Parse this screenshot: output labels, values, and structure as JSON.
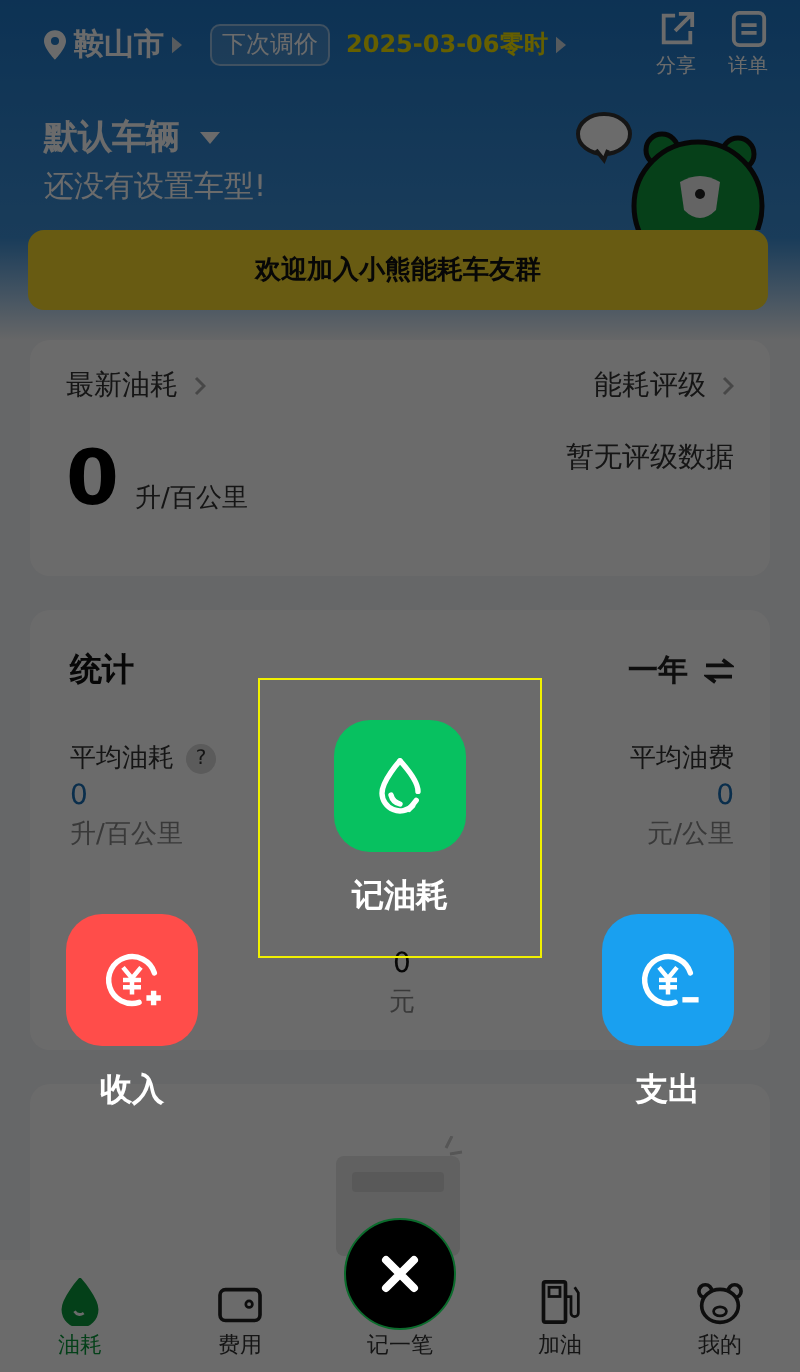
{
  "header": {
    "city": "鞍山市",
    "price_label": "下次调价",
    "price_date": "2025-03-06零时",
    "actions": [
      {
        "kind": "share",
        "label": "分享"
      },
      {
        "kind": "list",
        "label": "详单"
      }
    ]
  },
  "vehicle": {
    "name": "默认车辆",
    "subtitle": "还没有设置车型!"
  },
  "banner": "欢迎加入小熊能耗车友群",
  "latest": {
    "title": "最新油耗",
    "value": "0",
    "unit": "升/百公里",
    "rating_title": "能耗评级",
    "rating_text": "暂无评级数据"
  },
  "stats": {
    "title": "统计",
    "period": "一年",
    "row_1": [
      {
        "label": "平均油耗",
        "help": "?",
        "value": "0",
        "unit": "升/百公里"
      },
      {
        "label": "平均油费",
        "value": "0",
        "unit": "元/公里"
      }
    ],
    "row_2": [
      {
        "value": "0",
        "unit": "元"
      }
    ]
  },
  "quick_actions": [
    {
      "kind": "fuel",
      "label": "记油耗",
      "selected": true
    },
    {
      "kind": "income",
      "label": "收入",
      "selected": false
    },
    {
      "kind": "expense",
      "label": "支出",
      "selected": false
    }
  ],
  "nav": [
    {
      "kind": "drop",
      "label": "油耗",
      "selected": true
    },
    {
      "kind": "wallet",
      "label": "费用",
      "selected": false
    },
    {
      "kind": "add",
      "label": "记一笔",
      "selected": false
    },
    {
      "kind": "pump",
      "label": "加油",
      "selected": false
    },
    {
      "kind": "bear",
      "label": "我的",
      "selected": false
    }
  ]
}
